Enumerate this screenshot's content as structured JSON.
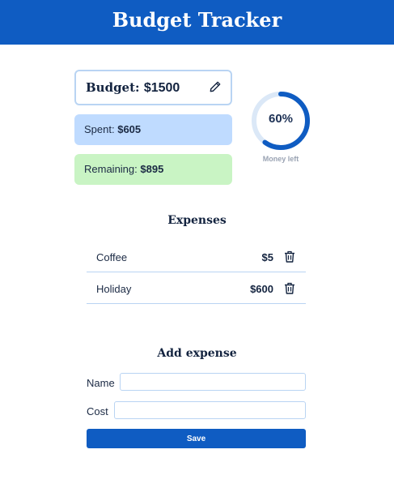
{
  "app": {
    "title": "Budget Tracker"
  },
  "budget": {
    "label": "Budget:",
    "amount": "$1500"
  },
  "spent": {
    "label": "Spent:",
    "amount": "$605"
  },
  "remaining": {
    "label": "Remaining:",
    "amount": "$895"
  },
  "money_left": {
    "percent_text": "60%",
    "fraction": 0.6,
    "caption": "Money left"
  },
  "expenses": {
    "title": "Expenses",
    "items": [
      {
        "name": "Coffee",
        "cost": "$5"
      },
      {
        "name": "Holiday",
        "cost": "$600"
      }
    ]
  },
  "add_expense": {
    "title": "Add expense",
    "name_label": "Name",
    "cost_label": "Cost",
    "name_value": "",
    "cost_value": "",
    "save_label": "Save"
  },
  "colors": {
    "brand": "#0f5cc2",
    "spent_bg": "#bfdbff",
    "remaining_bg": "#c9f4c4",
    "ring_track": "#dbe8f7"
  },
  "icons": {
    "edit": "pencil-icon",
    "delete": "trash-icon"
  }
}
